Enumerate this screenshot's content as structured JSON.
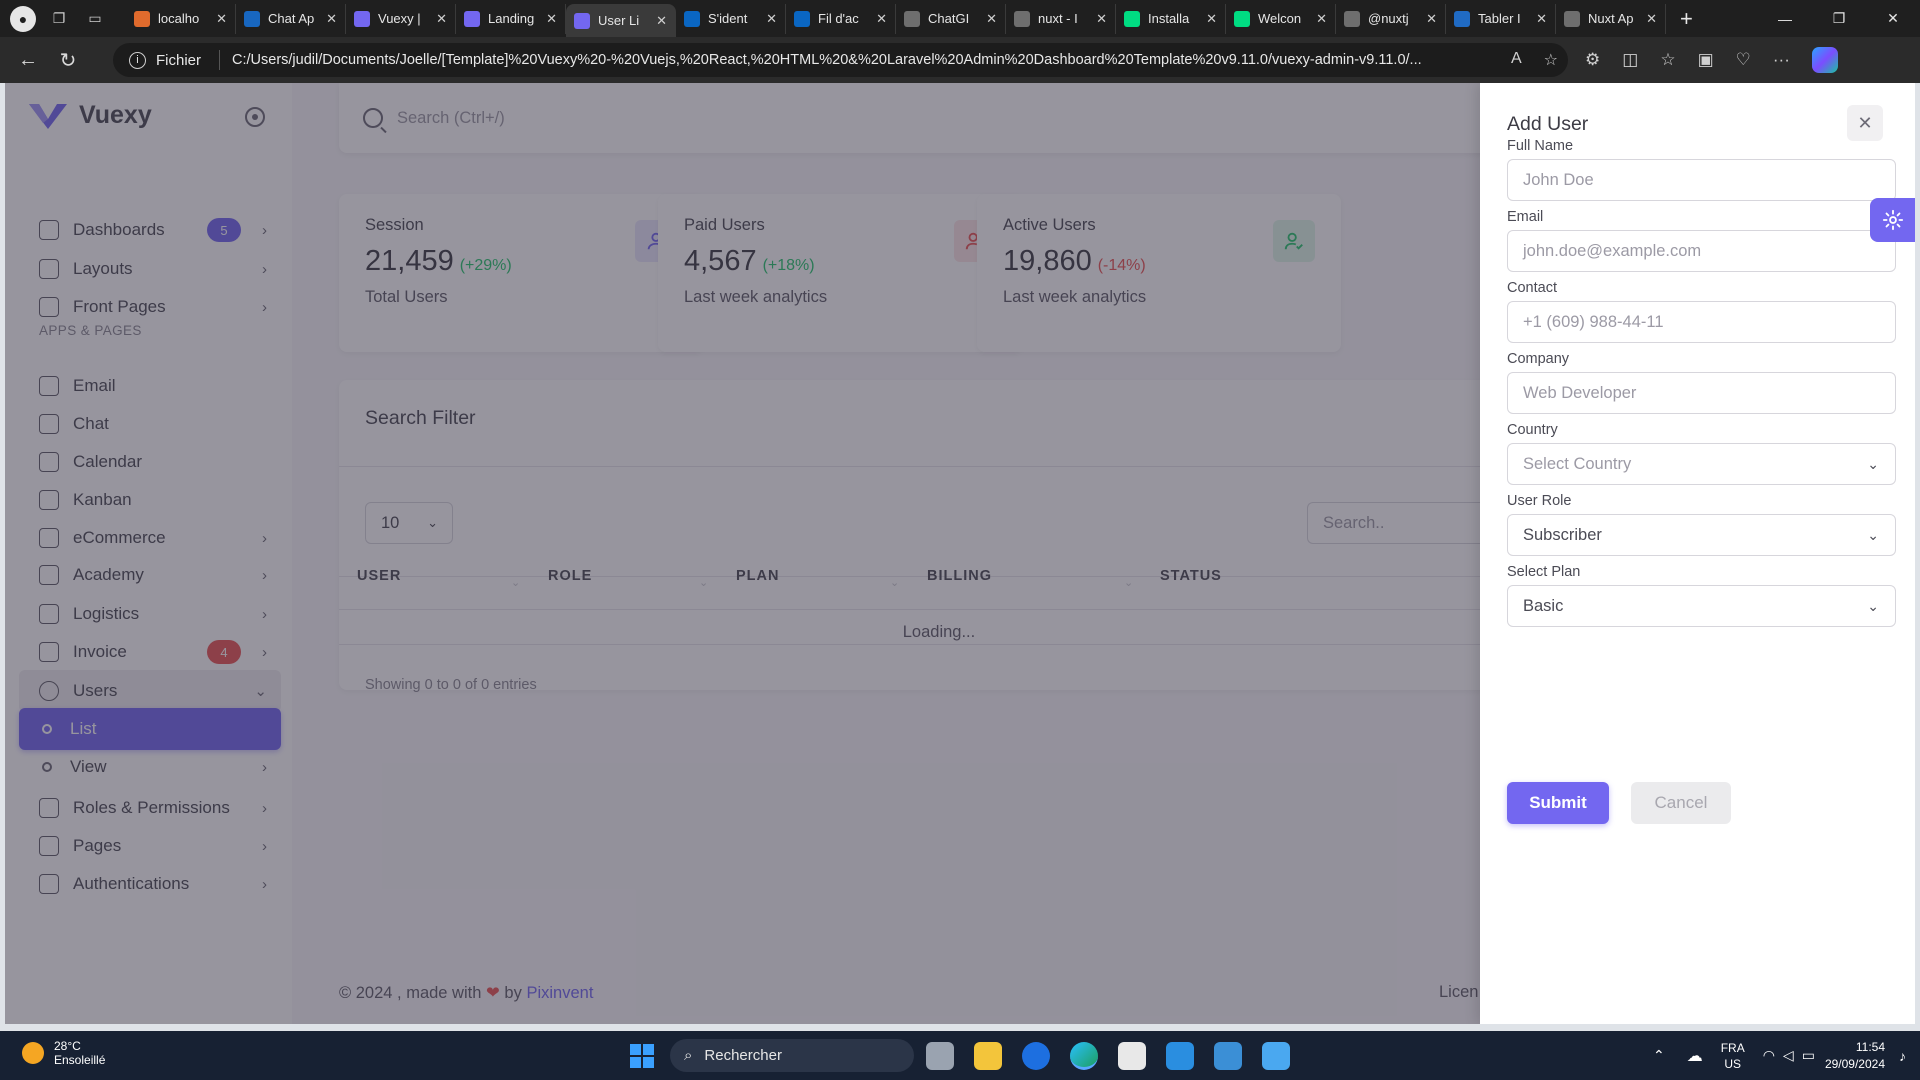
{
  "browser": {
    "tabs": [
      {
        "title": "localho",
        "icon": "vuexy-icon",
        "color": "#e06b2d"
      },
      {
        "title": "Chat Ap",
        "icon": "vuetify-icon",
        "color": "#1867c0"
      },
      {
        "title": "Vuexy |",
        "icon": "vuexy-icon",
        "color": "#7367f0"
      },
      {
        "title": "Landing",
        "icon": "vuexy-icon",
        "color": "#7367f0"
      },
      {
        "title": "User Li",
        "icon": "vuexy-icon",
        "color": "#7367f0",
        "active": true
      },
      {
        "title": "S'ident",
        "icon": "linkedin-icon",
        "color": "#0a66c2"
      },
      {
        "title": "Fil d'ac",
        "icon": "linkedin-icon",
        "color": "#0a66c2"
      },
      {
        "title": "ChatGI",
        "icon": "chatgpt-icon",
        "color": "#6e6e6e"
      },
      {
        "title": "nuxt - I",
        "icon": "search-icon",
        "color": "#6e6e6e"
      },
      {
        "title": "Installa",
        "icon": "nuxt-icon",
        "color": "#00dc82"
      },
      {
        "title": "Welcon",
        "icon": "nuxt-icon",
        "color": "#00dc82"
      },
      {
        "title": "@nuxtj",
        "icon": "search-icon",
        "color": "#6e6e6e"
      },
      {
        "title": "Tabler I",
        "icon": "terminal-icon",
        "color": "#206bc4"
      },
      {
        "title": "Nuxt Ap",
        "icon": "chatgpt-icon",
        "color": "#6e6e6e"
      }
    ],
    "address": {
      "scheme_label": "Fichier",
      "url": "C:/Users/judil/Documents/Joelle/[Template]%20Vuexy%20-%20Vuejs,%20React,%20HTML%20&%20Laravel%20Admin%20Dashboard%20Template%20v9.11.0/vuexy-admin-v9.11.0/..."
    }
  },
  "sidebar": {
    "brand": "Vuexy",
    "section_header": "APPS & PAGES",
    "items": [
      {
        "label": "Dashboards",
        "badge": "5",
        "badge_color": "#7367f0",
        "chevron": true
      },
      {
        "label": "Layouts",
        "chevron": true
      },
      {
        "label": "Front Pages",
        "chevron": true
      },
      {
        "label": "Email"
      },
      {
        "label": "Chat"
      },
      {
        "label": "Calendar"
      },
      {
        "label": "Kanban"
      },
      {
        "label": "eCommerce",
        "chevron": true
      },
      {
        "label": "Academy",
        "chevron": true
      },
      {
        "label": "Logistics",
        "chevron": true
      },
      {
        "label": "Invoice",
        "badge": "4",
        "badge_color": "#ea5455",
        "chevron": true
      },
      {
        "label": "Users",
        "open": true
      },
      {
        "label": "List",
        "active": true
      },
      {
        "label": "View",
        "chevron": true
      },
      {
        "label": "Roles & Permissions",
        "chevron": true
      },
      {
        "label": "Pages",
        "chevron": true
      },
      {
        "label": "Authentications",
        "chevron": true
      }
    ]
  },
  "search": {
    "placeholder": "Search (Ctrl+/)"
  },
  "stats": [
    {
      "label": "Session",
      "value": "21,459",
      "change": "(+29%)",
      "change_color": "#28c76f",
      "sub": "Total Users",
      "icon": "user-icon",
      "icon_color": "#7367f0",
      "icon_bg": "#e9e7fd"
    },
    {
      "label": "Paid Users",
      "value": "4,567",
      "change": "(+18%)",
      "change_color": "#28c76f",
      "sub": "Last week analytics",
      "icon": "user-plus-icon",
      "icon_color": "#ea5455",
      "icon_bg": "#fce5e6"
    },
    {
      "label": "Active Users",
      "value": "19,860",
      "change": "(-14%)",
      "change_color": "#ea5455",
      "sub": "Last week analytics",
      "icon": "user-check-icon",
      "icon_color": "#28c76f",
      "icon_bg": "#dff7e9"
    }
  ],
  "filter": {
    "title": "Search Filter",
    "per_page": "10",
    "table_search_placeholder": "Search..",
    "columns": [
      "USER",
      "ROLE",
      "PLAN",
      "BILLING",
      "STATUS"
    ],
    "loading_text": "Loading...",
    "showing_text": "Showing 0 to 0 of 0 entries"
  },
  "footer": {
    "prefix": "© 2024 , made with",
    "by": "by",
    "link": "Pixinvent",
    "right": "Licen"
  },
  "drawer": {
    "title": "Add User",
    "fields": [
      {
        "label": "Full Name",
        "placeholder": "John Doe"
      },
      {
        "label": "Email",
        "placeholder": "john.doe@example.com"
      },
      {
        "label": "Contact",
        "placeholder": "+1 (609) 988-44-11"
      },
      {
        "label": "Company",
        "placeholder": "Web Developer"
      },
      {
        "label": "Country",
        "placeholder": "Select Country",
        "select": true
      },
      {
        "label": "User Role",
        "value": "Subscriber",
        "select": true
      },
      {
        "label": "Select Plan",
        "value": "Basic",
        "select": true
      }
    ],
    "submit_label": "Submit",
    "cancel_label": "Cancel"
  },
  "taskbar": {
    "temperature": "28°C",
    "weather": "Ensoleillé",
    "search_label": "Rechercher",
    "lang_top": "FRA",
    "lang_bottom": "US",
    "time": "11:54",
    "date": "29/09/2024"
  },
  "colors": {
    "accent": "#7367f0",
    "success": "#28c76f",
    "danger": "#ea5455"
  }
}
